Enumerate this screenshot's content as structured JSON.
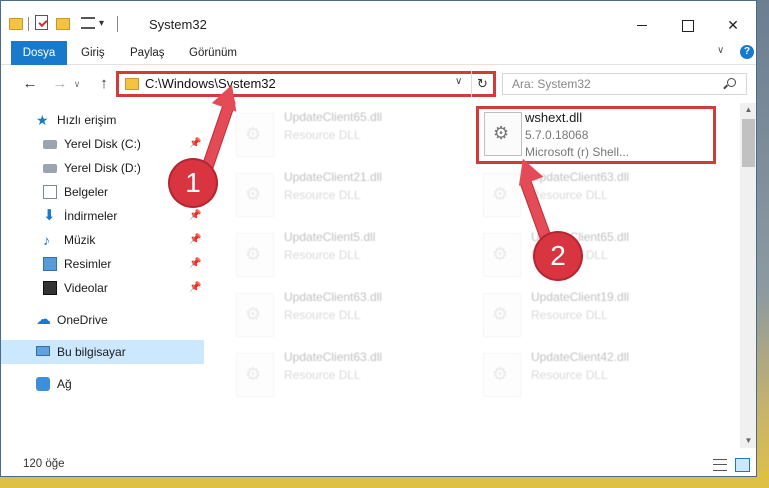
{
  "window": {
    "title": "System32",
    "quick_access": [
      "folder-icon",
      "properties-icon",
      "new-folder-icon",
      "view-icon"
    ]
  },
  "ribbon": {
    "tabs": [
      "Dosya",
      "Giriş",
      "Paylaş",
      "Görünüm"
    ],
    "help": "?"
  },
  "address": {
    "path": "C:\\Windows\\System32",
    "search_placeholder": "Ara: System32"
  },
  "sidebar": {
    "items": [
      {
        "label": "Hızlı erişim",
        "icon": "star-icon",
        "pinned": false
      },
      {
        "label": "Yerel Disk (C:)",
        "icon": "disk-icon",
        "pinned": true
      },
      {
        "label": "Yerel Disk (D:)",
        "icon": "disk-icon",
        "pinned": false
      },
      {
        "label": "Belgeler",
        "icon": "document-icon",
        "pinned": true
      },
      {
        "label": "İndirmeler",
        "icon": "download-icon",
        "pinned": true
      },
      {
        "label": "Müzik",
        "icon": "music-icon",
        "pinned": true
      },
      {
        "label": "Resimler",
        "icon": "pictures-icon",
        "pinned": true
      },
      {
        "label": "Videolar",
        "icon": "videos-icon",
        "pinned": true
      },
      {
        "label": "OneDrive",
        "icon": "cloud-icon",
        "pinned": false
      },
      {
        "label": "Bu bilgisayar",
        "icon": "computer-icon",
        "pinned": false,
        "selected": true
      },
      {
        "label": "Ağ",
        "icon": "network-icon",
        "pinned": false
      }
    ]
  },
  "files": [
    {
      "name": "UpdateClient65.dll",
      "type": "Resource DLL"
    },
    {
      "name": "wshext.dll",
      "version": "5.7.0.18068",
      "description": "Microsoft (r) Shell...",
      "highlighted": true
    },
    {
      "name": "UpdateClient21.dll",
      "type": "Resource DLL"
    },
    {
      "name": "UpdateClient63.dll",
      "type": "Resource DLL"
    },
    {
      "name": "UpdateClient5.dll",
      "type": "Resource DLL"
    },
    {
      "name": "UpdateClient65.dll",
      "type": "Resource DLL"
    },
    {
      "name": "UpdateClient63.dll",
      "type": "Resource DLL"
    },
    {
      "name": "UpdateClient19.dll",
      "type": "Resource DLL"
    },
    {
      "name": "UpdateClient63.dll",
      "type": "Resource DLL"
    },
    {
      "name": "UpdateClient42.dll",
      "type": "Resource DLL"
    }
  ],
  "status": {
    "count": "120 öğe"
  },
  "annotations": {
    "badge1": "1",
    "badge2": "2",
    "color": "#e34b57"
  }
}
